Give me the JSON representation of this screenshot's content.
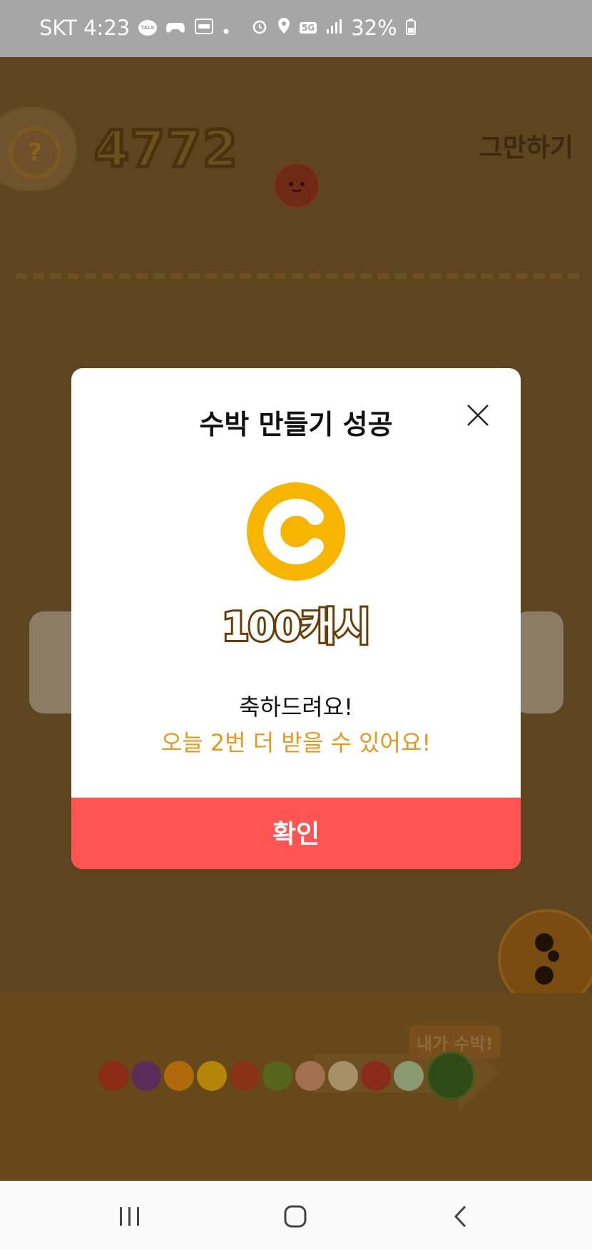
{
  "status_bar": {
    "carrier_time": "SKT 4:23",
    "talk_badge": "TALK",
    "battery": "32%",
    "network": "5G",
    "icons": [
      "talk-icon",
      "game-controller-icon",
      "app-badge-icon",
      "dot-icon",
      "alarm-icon",
      "location-icon",
      "5g-icon",
      "signal-icon",
      "battery-icon"
    ]
  },
  "game": {
    "help_label": "?",
    "score": "4772",
    "quit_label": "그만하기",
    "tag_label": "내가 수박!",
    "fruit_colors": [
      "#8a2a17",
      "#5b2b5a",
      "#b06a0c",
      "#b3860a",
      "#8a3314",
      "#55651c",
      "#a07050",
      "#a79068",
      "#8a2a18",
      "#8a9a70"
    ],
    "watermelon_color": "#2f4a16"
  },
  "modal": {
    "title": "수박 만들기 성공",
    "coin_letter": "C",
    "reward": "100캐시",
    "message_1": "축하드려요!",
    "message_2": "오늘 2번 더 받을 수 있어요!",
    "confirm_label": "확인",
    "accent_color": "#ff5451",
    "highlight_color": "#e39a1b",
    "coin_color": "#f7b500"
  },
  "navbar": {
    "icons": [
      "recent-apps-icon",
      "home-icon",
      "back-icon"
    ]
  }
}
